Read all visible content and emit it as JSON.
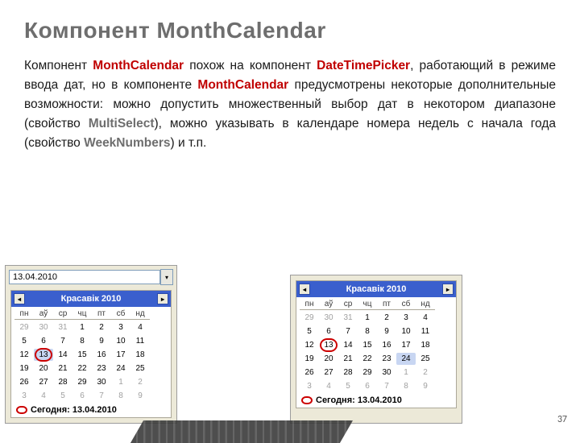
{
  "pageNumber": "37",
  "title": "Компонент MonthCalendar",
  "paragraph": {
    "t0": "Компонент ",
    "kw0": "MonthCalendar",
    "t1": " похож на компонент ",
    "kw1": "DateTimePicker",
    "t2": ", работающий в режиме ввода дат, но в компоненте ",
    "kw2": "MonthCalendar",
    "t3": " предусмотрены некоторые дополнительные возможности: можно допустить множественный выбор дат в некотором диапазоне (свойство ",
    "kw3": "MultiSelect",
    "t4": "), можно указывать в календаре номера недель с начала года (свойство ",
    "kw4": "WeekNumbers",
    "t5": ") и т.п."
  },
  "calLeft": {
    "inputValue": "13.04.2010",
    "title": "Красавік 2010",
    "dow": [
      "пн",
      "аў",
      "ср",
      "чц",
      "пт",
      "сб",
      "нд"
    ],
    "weeks": [
      [
        {
          "n": "29",
          "o": true
        },
        {
          "n": "30",
          "o": true
        },
        {
          "n": "31",
          "o": true
        },
        {
          "n": "1"
        },
        {
          "n": "2"
        },
        {
          "n": "3"
        },
        {
          "n": "4"
        }
      ],
      [
        {
          "n": "5"
        },
        {
          "n": "6"
        },
        {
          "n": "7"
        },
        {
          "n": "8"
        },
        {
          "n": "9"
        },
        {
          "n": "10"
        },
        {
          "n": "11"
        }
      ],
      [
        {
          "n": "12"
        },
        {
          "n": "13",
          "today": true,
          "sel": true
        },
        {
          "n": "14"
        },
        {
          "n": "15"
        },
        {
          "n": "16"
        },
        {
          "n": "17"
        },
        {
          "n": "18"
        }
      ],
      [
        {
          "n": "19"
        },
        {
          "n": "20"
        },
        {
          "n": "21"
        },
        {
          "n": "22"
        },
        {
          "n": "23"
        },
        {
          "n": "24"
        },
        {
          "n": "25"
        }
      ],
      [
        {
          "n": "26"
        },
        {
          "n": "27"
        },
        {
          "n": "28"
        },
        {
          "n": "29"
        },
        {
          "n": "30"
        },
        {
          "n": "1",
          "o": true
        },
        {
          "n": "2",
          "o": true
        }
      ],
      [
        {
          "n": "3",
          "o": true
        },
        {
          "n": "4",
          "o": true
        },
        {
          "n": "5",
          "o": true
        },
        {
          "n": "6",
          "o": true
        },
        {
          "n": "7",
          "o": true
        },
        {
          "n": "8",
          "o": true
        },
        {
          "n": "9",
          "o": true
        }
      ]
    ],
    "todayLabel": "Сегодня: 13.04.2010"
  },
  "calRight": {
    "title": "Красавік 2010",
    "dow": [
      "пн",
      "аў",
      "ср",
      "чц",
      "пт",
      "сб",
      "нд"
    ],
    "weeks": [
      [
        {
          "n": "29",
          "o": true
        },
        {
          "n": "30",
          "o": true
        },
        {
          "n": "31",
          "o": true
        },
        {
          "n": "1"
        },
        {
          "n": "2"
        },
        {
          "n": "3"
        },
        {
          "n": "4"
        }
      ],
      [
        {
          "n": "5"
        },
        {
          "n": "6"
        },
        {
          "n": "7"
        },
        {
          "n": "8"
        },
        {
          "n": "9"
        },
        {
          "n": "10"
        },
        {
          "n": "11"
        }
      ],
      [
        {
          "n": "12"
        },
        {
          "n": "13",
          "today": true
        },
        {
          "n": "14"
        },
        {
          "n": "15"
        },
        {
          "n": "16"
        },
        {
          "n": "17"
        },
        {
          "n": "18"
        }
      ],
      [
        {
          "n": "19"
        },
        {
          "n": "20"
        },
        {
          "n": "21"
        },
        {
          "n": "22"
        },
        {
          "n": "23"
        },
        {
          "n": "24",
          "sel": true
        },
        {
          "n": "25"
        }
      ],
      [
        {
          "n": "26"
        },
        {
          "n": "27"
        },
        {
          "n": "28"
        },
        {
          "n": "29"
        },
        {
          "n": "30"
        },
        {
          "n": "1",
          "o": true
        },
        {
          "n": "2",
          "o": true
        }
      ],
      [
        {
          "n": "3",
          "o": true
        },
        {
          "n": "4",
          "o": true
        },
        {
          "n": "5",
          "o": true
        },
        {
          "n": "6",
          "o": true
        },
        {
          "n": "7",
          "o": true
        },
        {
          "n": "8",
          "o": true
        },
        {
          "n": "9",
          "o": true
        }
      ]
    ],
    "todayLabel": "Сегодня: 13.04.2010"
  }
}
